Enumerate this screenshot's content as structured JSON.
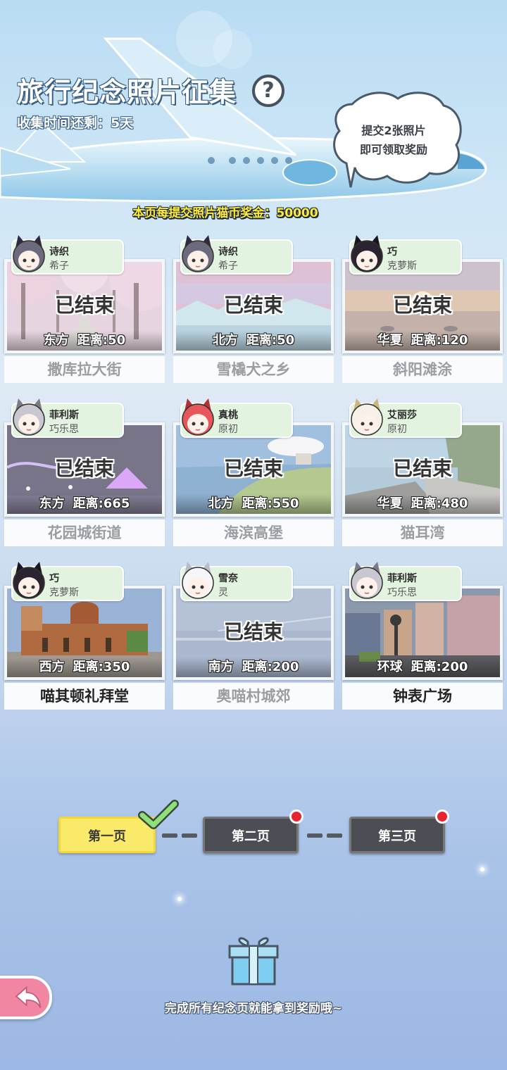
{
  "header": {
    "title": "旅行纪念照片征集",
    "help_icon": "?",
    "remaining_label": "收集时间还剩：",
    "remaining_value": "5天",
    "bubble_line1": "提交2张照片",
    "bubble_line2": "即可领取奖励",
    "bonus_text": "本页每提交照片猫币奖金：50000"
  },
  "cards": [
    {
      "user1": "诗织",
      "user2": "希子",
      "ended": "已结束",
      "dir": "东方",
      "dist_label": "距离:50",
      "name": "撒库拉大街",
      "finished": true,
      "photo": "cherry"
    },
    {
      "user1": "诗织",
      "user2": "希子",
      "ended": "已结束",
      "dir": "北方",
      "dist_label": "距离:50",
      "name": "雪橇犬之乡",
      "finished": true,
      "photo": "ice"
    },
    {
      "user1": "巧",
      "user2": "克萝斯",
      "ended": "已结束",
      "dir": "华夏",
      "dist_label": "距离:120",
      "name": "斜阳滩涂",
      "finished": true,
      "photo": "sunset"
    },
    {
      "user1": "菲利斯",
      "user2": "巧乐思",
      "ended": "已结束",
      "dir": "东方",
      "dist_label": "距离:665",
      "name": "花园城街道",
      "finished": true,
      "photo": "night"
    },
    {
      "user1": "真桃",
      "user2": "原初",
      "ended": "已结束",
      "dir": "北方",
      "dist_label": "距离:550",
      "name": "海滨高堡",
      "finished": true,
      "photo": "coast"
    },
    {
      "user1": "艾丽莎",
      "user2": "原初",
      "ended": "已结束",
      "dir": "华夏",
      "dist_label": "距离:480",
      "name": "猫耳湾",
      "finished": true,
      "photo": "bay"
    },
    {
      "user1": "巧",
      "user2": "克萝斯",
      "ended": "",
      "dir": "西方",
      "dist_label": "距离:350",
      "name": "喵其顿礼拜堂",
      "finished": false,
      "photo": "church"
    },
    {
      "user1": "雪奈",
      "user2": "灵",
      "ended": "已结束",
      "dir": "南方",
      "dist_label": "距离:200",
      "name": "奥喵村城郊",
      "finished": true,
      "photo": "sea"
    },
    {
      "user1": "菲利斯",
      "user2": "巧乐思",
      "ended": "",
      "dir": "环球",
      "dist_label": "距离:200",
      "name": "钟表广场",
      "finished": false,
      "photo": "town"
    }
  ],
  "pager": {
    "page1": "第一页",
    "page2": "第二页",
    "page3": "第三页",
    "active_color": "#fbe96a",
    "inactive_color": "#4b4e55"
  },
  "footer": {
    "hint": "完成所有纪念页就能拿到奖励哦~"
  },
  "icons": [
    "help-icon",
    "check-icon",
    "gift-icon",
    "back-arrow-icon",
    "notification-dot-icon"
  ]
}
